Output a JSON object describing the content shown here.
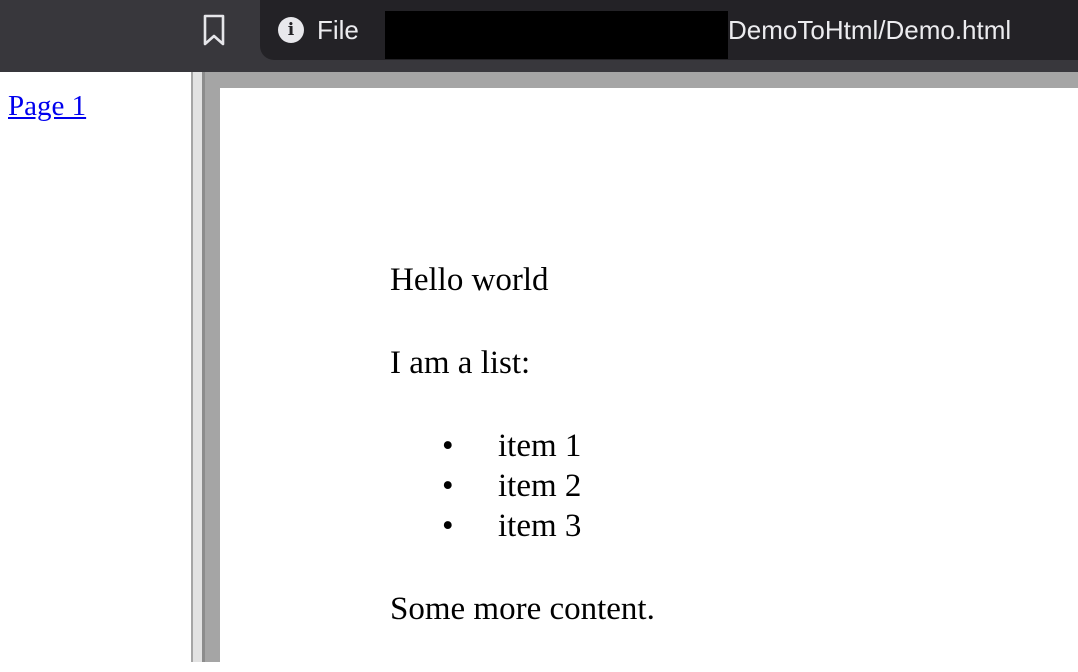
{
  "browser": {
    "url_scheme": "File",
    "url_path": "DemoToHtml/Demo.html",
    "info_icon": "info-icon",
    "bookmark_icon": "bookmark-icon"
  },
  "sidebar": {
    "items": [
      {
        "label": "Page 1"
      }
    ]
  },
  "document": {
    "heading": "Hello world",
    "list_intro": "I am a list:",
    "list_items": [
      "item 1",
      "item 2",
      "item 3"
    ],
    "footer_text": "Some more content."
  }
}
